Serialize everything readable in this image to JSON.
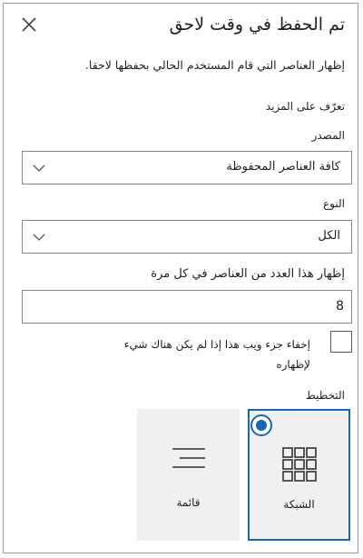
{
  "header": {
    "title": "تم الحفظ في وقت لاحق",
    "close_icon": "close-icon"
  },
  "description": "إظهار العناصر التي قام المستخدم الحالي بحفظها لاحقا.",
  "learn_more": "تعرّف على المزيد",
  "source": {
    "label": "المصدر",
    "value": "كافة العناصر المحفوظة"
  },
  "type": {
    "label": "النوع",
    "value": "الكل"
  },
  "count": {
    "label": "إظهار هذا العدد من العناصر في كل مرة",
    "value": "8"
  },
  "hide_if_empty": {
    "label": "إخفاء جزء ويب هذا إذا لم يكن هناك شيء لإظهاره",
    "checked": false
  },
  "layout": {
    "label": "التخطيط",
    "options": [
      {
        "label": "الشبكة",
        "icon": "grid-icon",
        "selected": true
      },
      {
        "label": "قائمة",
        "icon": "list-icon",
        "selected": false
      }
    ]
  },
  "colors": {
    "accent": "#1565b8",
    "tile_bg": "#f0f0f0",
    "border": "#8a8a8a"
  }
}
